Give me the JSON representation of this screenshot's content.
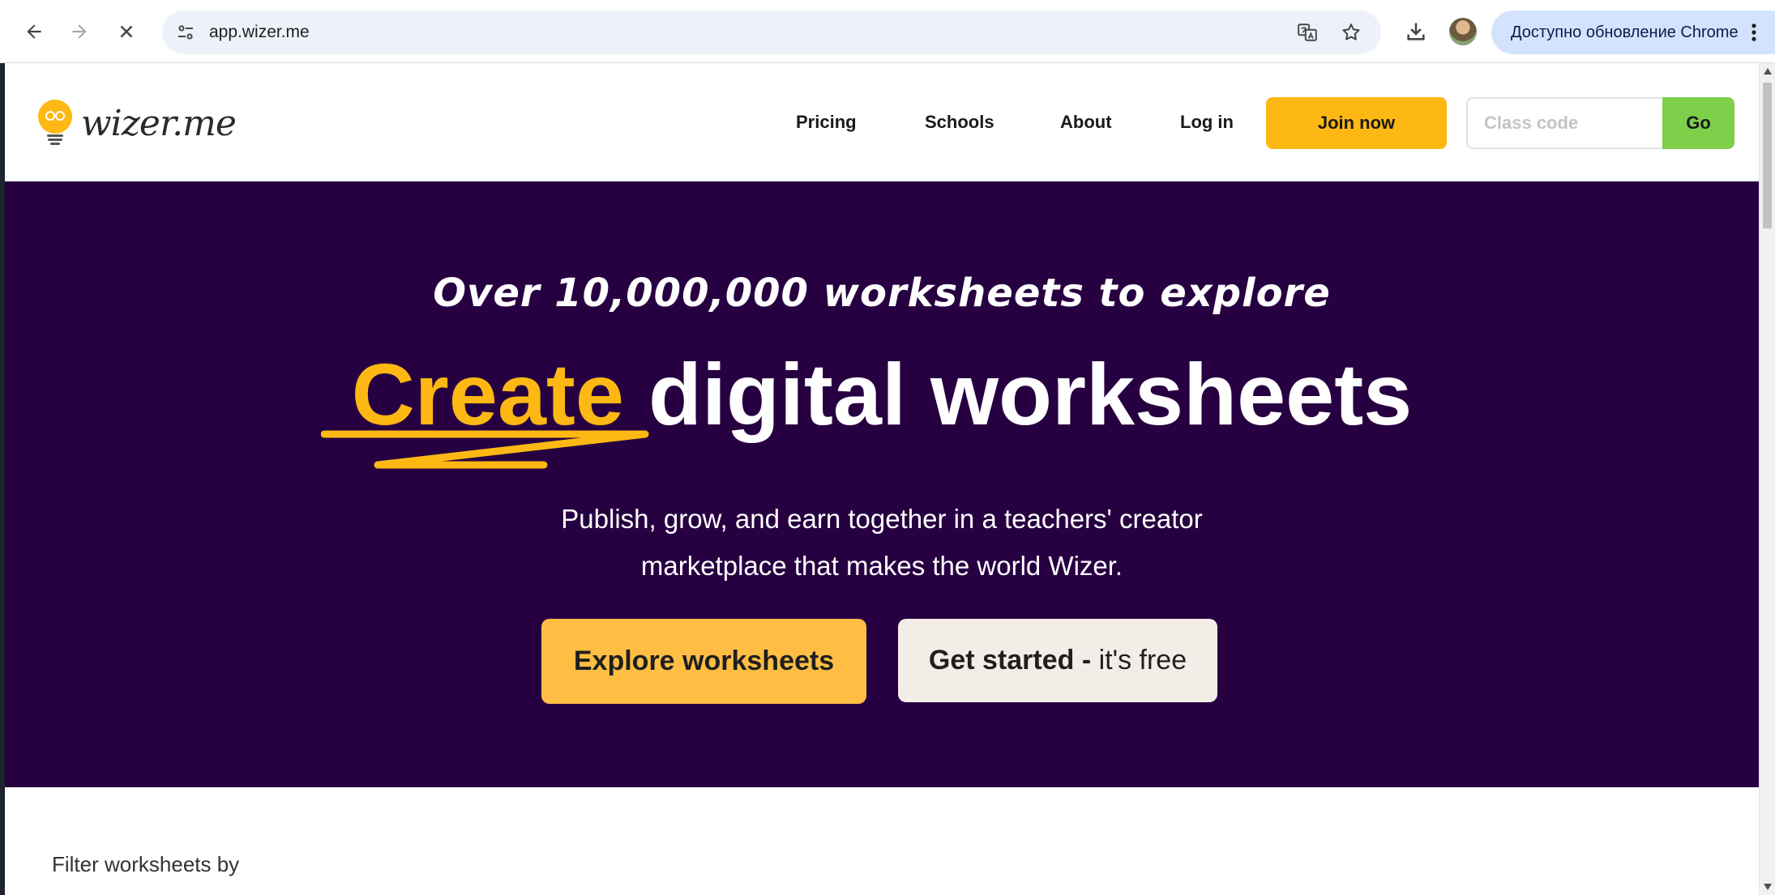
{
  "browser": {
    "url": "app.wizer.me",
    "update_label": "Доступно обновление Chrome"
  },
  "site": {
    "logo_text": "wizer.me",
    "nav": {
      "pricing": "Pricing",
      "schools": "Schools",
      "about": "About",
      "login": "Log in"
    },
    "join_label": "Join now",
    "class_code_placeholder": "Class code",
    "go_label": "Go"
  },
  "hero": {
    "kicker": "Over 10,000,000 worksheets to explore",
    "title_accent": "Create",
    "title_rest": "digital worksheets",
    "subtitle_line1": "Publish, grow, and earn together in a teachers' creator",
    "subtitle_line2": "marketplace that makes the world Wizer.",
    "explore_label": "Explore worksheets",
    "started_strong": "Get started -",
    "started_rest": "it's free"
  },
  "filter": {
    "label": "Filter worksheets by"
  },
  "colors": {
    "brand_yellow": "#fdb813",
    "hero_bg": "#270041",
    "go_green": "#7ed04b",
    "explore_bg": "#ffbe43",
    "started_bg": "#f3ede8"
  }
}
